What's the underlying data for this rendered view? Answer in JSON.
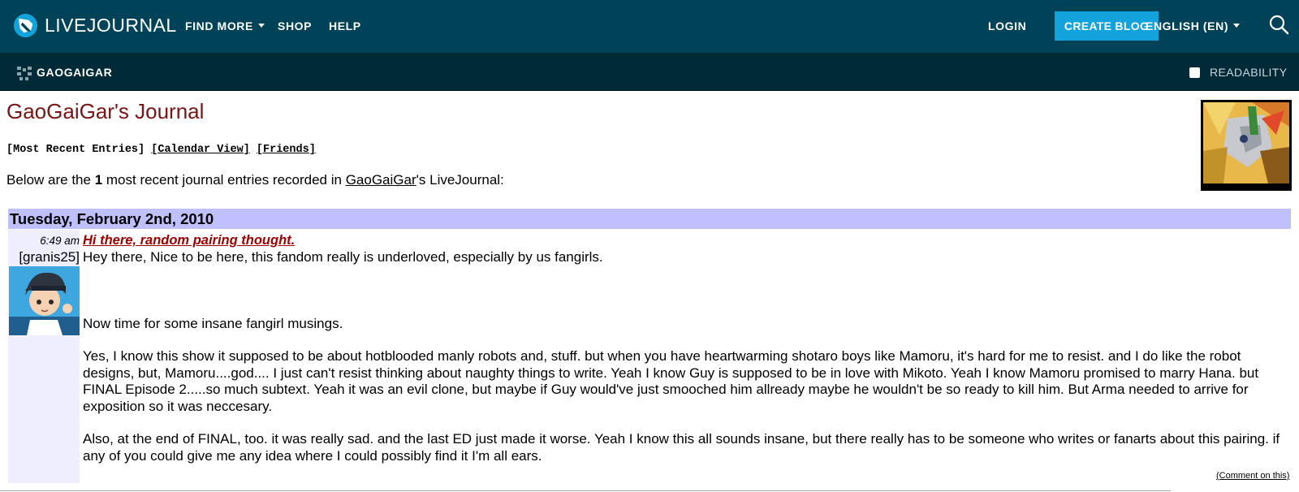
{
  "header": {
    "brand": "LIVEJOURNAL",
    "nav": {
      "find_more": "FIND MORE",
      "shop": "SHOP",
      "help": "HELP"
    },
    "login": "LOGIN",
    "create_blog": "CREATE BLOG",
    "language": "ENGLISH (EN)",
    "icons": {
      "logo": "livejournal-pencil-logo",
      "search": "search-icon"
    },
    "colors": {
      "topbar": "#004359",
      "userbar": "#002a38",
      "accent": "#13a3dc"
    }
  },
  "userbar": {
    "journal_name": "GAOGAIGAR",
    "readability": "READABILITY"
  },
  "journal": {
    "title": "GaoGaiGar's Journal",
    "views": {
      "recent": "[Most Recent Entries]",
      "calendar": "[Calendar View]",
      "friends": "[Friends]"
    },
    "intro": {
      "before": "Below are the ",
      "count": "1",
      "middle": " most recent journal entries recorded in ",
      "user": "GaoGaiGar",
      "after": "'s LiveJournal:"
    }
  },
  "entry": {
    "date": "Tuesday, February 2nd, 2010",
    "time": "6:49 am",
    "subject": "Hi there, random pairing thought.",
    "poster": "[granis25]",
    "body": {
      "p1": "Hey there, Nice to be here, this fandom really is underloved, especially by us fangirls.",
      "p2": "Now time for some insane fangirl musings.",
      "p3": "Yes, I know this show it supposed to be about hotblooded manly robots and, stuff. but when you have heartwarming shotaro boys like Mamoru, it's hard for me to resist. and I do like the robot designs, but, Mamoru....god.... I just can't resist thinking about naughty things to write. Yeah I know Guy is supposed to be in love with Mikoto. Yeah I know Mamoru promised to marry Hana. but FINAL Episode 2.....so much subtext. Yeah it was an evil clone, but maybe if Guy would've just smooched him allready maybe he wouldn't be so ready to kill him. But Arma needed to arrive for exposition so it was neccesary.",
      "p4": "Also, at the end of FINAL, too. it was really sad. and the last ED just made it worse. Yeah I know this all sounds insane, but there really has to be someone who writes or fanarts about this pairing. if any of you could give me any idea where I could possibly find it I'm all ears."
    },
    "comment_link": "(Comment on this)"
  }
}
